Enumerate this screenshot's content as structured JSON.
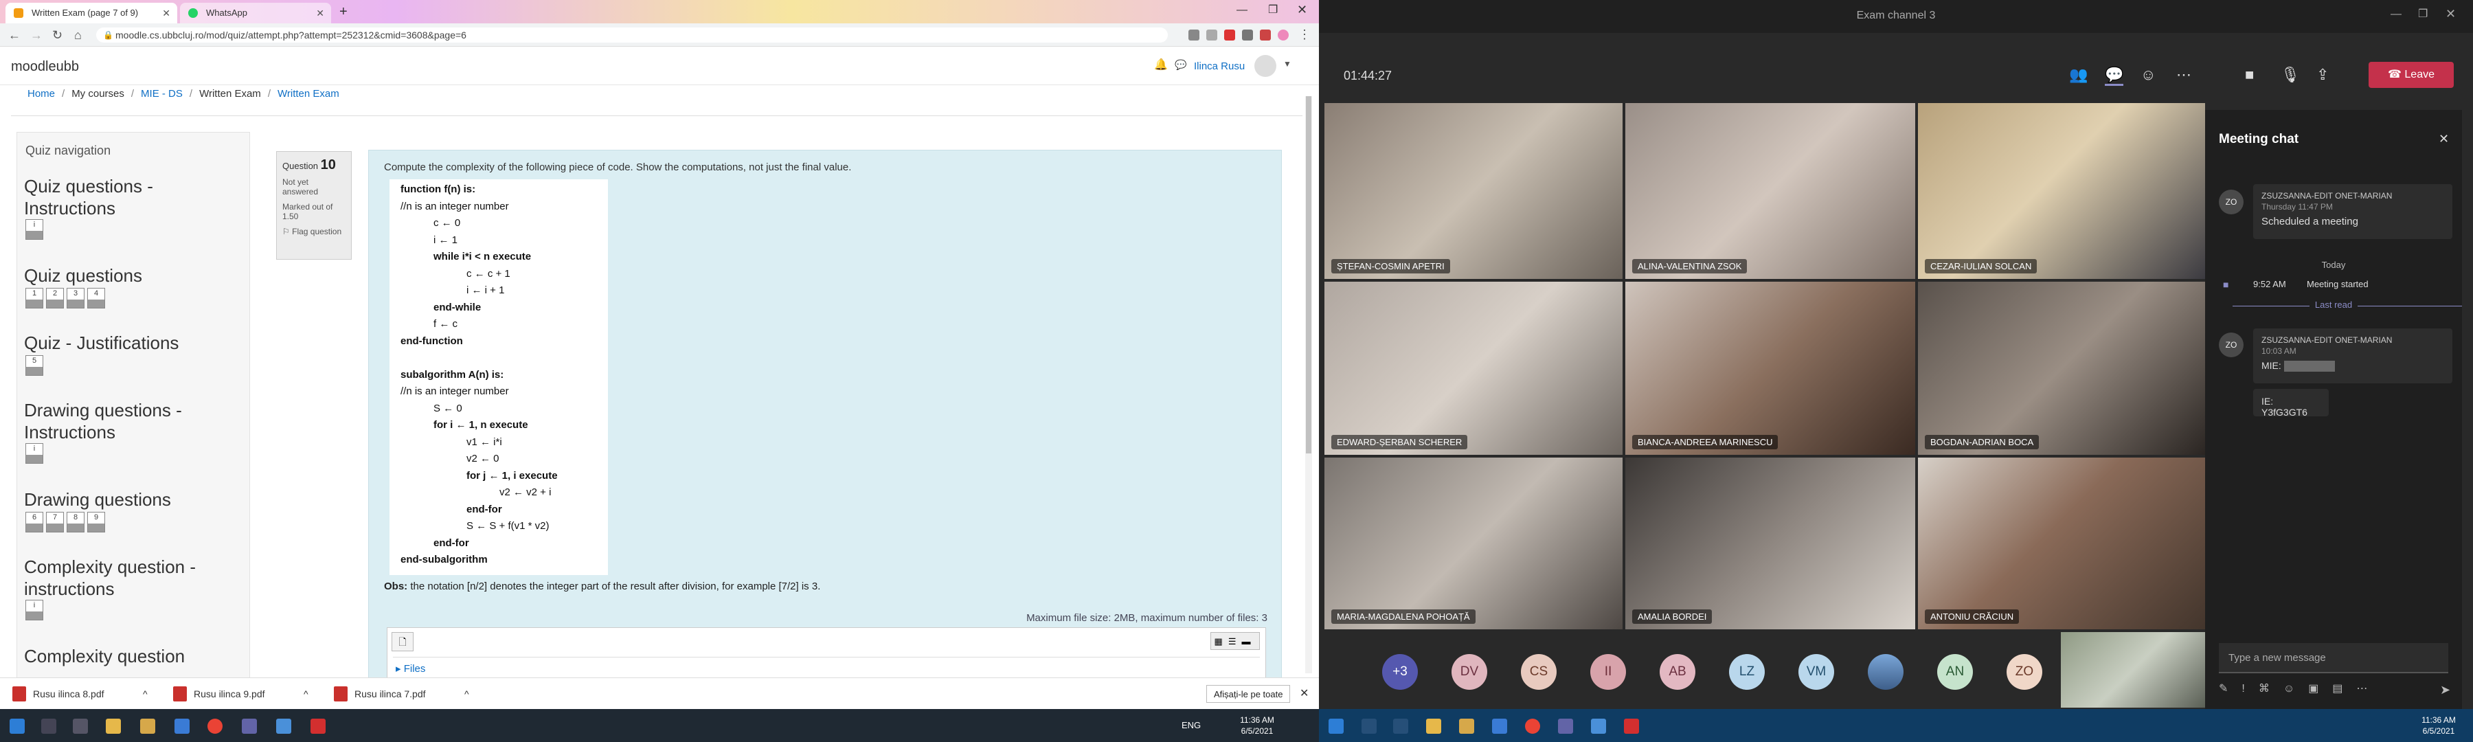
{
  "browser": {
    "tabs": [
      {
        "label": "Written Exam (page 7 of 9)",
        "active": true
      },
      {
        "label": "WhatsApp",
        "active": false
      }
    ],
    "url": "moodle.cs.ubbcluj.ro/mod/quiz/attempt.php?attempt=252312&cmid=3608&page=6"
  },
  "moodle": {
    "brand": "moodleubb",
    "user": "Ilinca Rusu",
    "breadcrumb": [
      "Home",
      "My courses",
      "MIE - DS",
      "Written Exam",
      "Written Exam"
    ],
    "quiz_nav": {
      "title": "Quiz navigation",
      "sections": [
        {
          "title": "Quiz questions - Instructions",
          "buttons": [
            "i"
          ]
        },
        {
          "title": "Quiz questions",
          "buttons": [
            "1",
            "2",
            "3",
            "4"
          ]
        },
        {
          "title": "Quiz - Justifications",
          "buttons": [
            "5"
          ]
        },
        {
          "title": "Drawing questions - Instructions",
          "buttons": [
            "i"
          ]
        },
        {
          "title": "Drawing questions",
          "buttons": [
            "6",
            "7",
            "8",
            "9"
          ]
        },
        {
          "title": "Complexity question - instructions",
          "buttons": [
            "i"
          ]
        },
        {
          "title": "Complexity question",
          "buttons": []
        }
      ]
    },
    "question": {
      "label": "Question",
      "number": "10",
      "status": "Not yet answered",
      "marks": "Marked out of 1.50",
      "flag": "Flag question",
      "text": "Compute the complexity of the following piece of code. Show the computations, not just the final value.",
      "code": [
        {
          "t": "function f(n) is:",
          "b": true,
          "i": 0
        },
        {
          "t": "//n is an integer number",
          "b": false,
          "i": 0
        },
        {
          "t": "c ← 0",
          "b": false,
          "i": 1
        },
        {
          "t": "i ← 1",
          "b": false,
          "i": 1
        },
        {
          "t": "while i*i < n execute",
          "b": true,
          "i": 1
        },
        {
          "t": "c ← c + 1",
          "b": false,
          "i": 2
        },
        {
          "t": "i ← i + 1",
          "b": false,
          "i": 2
        },
        {
          "t": "end-while",
          "b": true,
          "i": 1
        },
        {
          "t": "f ← c",
          "b": false,
          "i": 1
        },
        {
          "t": "end-function",
          "b": true,
          "i": 0
        },
        {
          "t": "",
          "b": false,
          "i": 0
        },
        {
          "t": "subalgorithm A(n) is:",
          "b": true,
          "i": 0
        },
        {
          "t": "//n is an integer number",
          "b": false,
          "i": 0
        },
        {
          "t": "S ← 0",
          "b": false,
          "i": 1
        },
        {
          "t": "for i ← 1, n execute",
          "b": true,
          "i": 1
        },
        {
          "t": "v1 ← i*i",
          "b": false,
          "i": 2
        },
        {
          "t": "v2 ← 0",
          "b": false,
          "i": 2
        },
        {
          "t": "for j ← 1, i execute",
          "b": true,
          "i": 2
        },
        {
          "t": "v2 ← v2 + i",
          "b": false,
          "i": 3
        },
        {
          "t": "end-for",
          "b": true,
          "i": 2
        },
        {
          "t": "S ← S + f(v1 * v2)",
          "b": false,
          "i": 2
        },
        {
          "t": "end-for",
          "b": true,
          "i": 1
        },
        {
          "t": "end-subalgorithm",
          "b": true,
          "i": 0
        }
      ],
      "obs_label": "Obs:",
      "obs": "the notation [n/2] denotes the integer part of the result after division, for example [7/2] is 3.",
      "max_files": "Maximum file size: 2MB, maximum number of files: 3",
      "files_label": "Files"
    },
    "downloads": [
      "Rusu ilinca 8.pdf",
      "Rusu ilinca 9.pdf",
      "Rusu ilinca 7.pdf"
    ],
    "show_all": "Afișați-le pe toate",
    "clock": {
      "time": "11:36 AM",
      "date": "6/5/2021"
    },
    "lang": "ENG"
  },
  "teams": {
    "title": "Exam channel 3",
    "timer": "01:44:27",
    "leave": "Leave",
    "participants": [
      "ȘTEFAN-COSMIN APETRI",
      "ALINA-VALENTINA ZSOK",
      "CEZAR-IULIAN SOLCAN",
      "EDWARD-ȘERBAN SCHERER",
      "BIANCA-ANDREEA MARINESCU",
      "BOGDAN-ADRIAN BOCA",
      "MARIA-MAGDALENA POHOAȚĂ",
      "AMALIA BORDEI",
      "ANTONIU CRĂCIUN"
    ],
    "avatars": [
      "+3",
      "DV",
      "CS",
      "II",
      "AB",
      "LZ",
      "VM",
      "",
      "AN",
      "ZO"
    ],
    "chat": {
      "title": "Meeting chat",
      "msg1_sender": "ZSUZSANNA-EDIT ONET-MARIAN",
      "msg1_time": "Thursday 11:47 PM",
      "msg1_text": "Scheduled a meeting",
      "today": "Today",
      "started_time": "9:52 AM",
      "started_text": "Meeting started",
      "last_read": "Last read",
      "msg2_sender": "ZSUZSANNA-EDIT ONET-MARIAN",
      "msg2_time": "10:03 AM",
      "msg2_line1_label": "MIE:",
      "msg2_line2": "IE: Y3fG3GT6",
      "avatar_initials": "ZO",
      "compose": "Type a new message"
    },
    "clock": {
      "time": "11:36 AM",
      "date": "6/5/2021"
    }
  }
}
